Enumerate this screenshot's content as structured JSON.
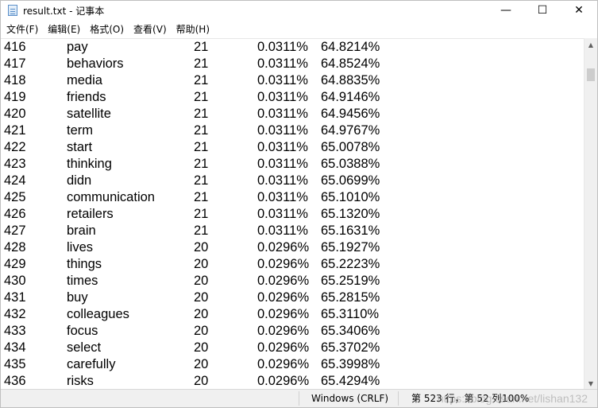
{
  "window": {
    "title": "result.txt - 记事本",
    "controls": {
      "minimize": "—",
      "maximize": "☐",
      "close": "✕"
    }
  },
  "menu": [
    {
      "label": "文件(F)"
    },
    {
      "label": "编辑(E)"
    },
    {
      "label": "格式(O)"
    },
    {
      "label": "查看(V)"
    },
    {
      "label": "帮助(H)"
    }
  ],
  "lines": [
    {
      "idx": "416",
      "word": "pay",
      "count": "21",
      "pct": "0.0311%",
      "cum": "64.8214%"
    },
    {
      "idx": "417",
      "word": "behaviors",
      "count": "21",
      "pct": "0.0311%",
      "cum": "64.8524%"
    },
    {
      "idx": "418",
      "word": "media",
      "count": "21",
      "pct": "0.0311%",
      "cum": "64.8835%"
    },
    {
      "idx": "419",
      "word": "friends",
      "count": "21",
      "pct": "0.0311%",
      "cum": "64.9146%"
    },
    {
      "idx": "420",
      "word": "satellite",
      "count": "21",
      "pct": "0.0311%",
      "cum": "64.9456%"
    },
    {
      "idx": "421",
      "word": "term",
      "count": "21",
      "pct": "0.0311%",
      "cum": "64.9767%"
    },
    {
      "idx": "422",
      "word": "start",
      "count": "21",
      "pct": "0.0311%",
      "cum": "65.0078%"
    },
    {
      "idx": "423",
      "word": "thinking",
      "count": "21",
      "pct": "0.0311%",
      "cum": "65.0388%"
    },
    {
      "idx": "424",
      "word": "didn",
      "count": "21",
      "pct": "0.0311%",
      "cum": "65.0699%"
    },
    {
      "idx": "425",
      "word": "communication",
      "count": "21",
      "pct": "0.0311%",
      "cum": "65.1010%"
    },
    {
      "idx": "426",
      "word": "retailers",
      "count": "21",
      "pct": "0.0311%",
      "cum": "65.1320%"
    },
    {
      "idx": "427",
      "word": "brain",
      "count": "21",
      "pct": "0.0311%",
      "cum": "65.1631%"
    },
    {
      "idx": "428",
      "word": "lives",
      "count": "20",
      "pct": "0.0296%",
      "cum": "65.1927%"
    },
    {
      "idx": "429",
      "word": "things",
      "count": "20",
      "pct": "0.0296%",
      "cum": "65.2223%"
    },
    {
      "idx": "430",
      "word": "times",
      "count": "20",
      "pct": "0.0296%",
      "cum": "65.2519%"
    },
    {
      "idx": "431",
      "word": "buy",
      "count": "20",
      "pct": "0.0296%",
      "cum": "65.2815%"
    },
    {
      "idx": "432",
      "word": "colleagues",
      "count": "20",
      "pct": "0.0296%",
      "cum": "65.3110%"
    },
    {
      "idx": "433",
      "word": "focus",
      "count": "20",
      "pct": "0.0296%",
      "cum": "65.3406%"
    },
    {
      "idx": "434",
      "word": "select",
      "count": "20",
      "pct": "0.0296%",
      "cum": "65.3702%"
    },
    {
      "idx": "435",
      "word": "carefully",
      "count": "20",
      "pct": "0.0296%",
      "cum": "65.3998%"
    },
    {
      "idx": "436",
      "word": "risks",
      "count": "20",
      "pct": "0.0296%",
      "cum": "65.4294%"
    }
  ],
  "status": {
    "encoding": "Windows (CRLF)",
    "position": "第 523 行，第 52 列",
    "zoom": "100%"
  },
  "watermark": "https://blog.csdn.net/lishan132"
}
